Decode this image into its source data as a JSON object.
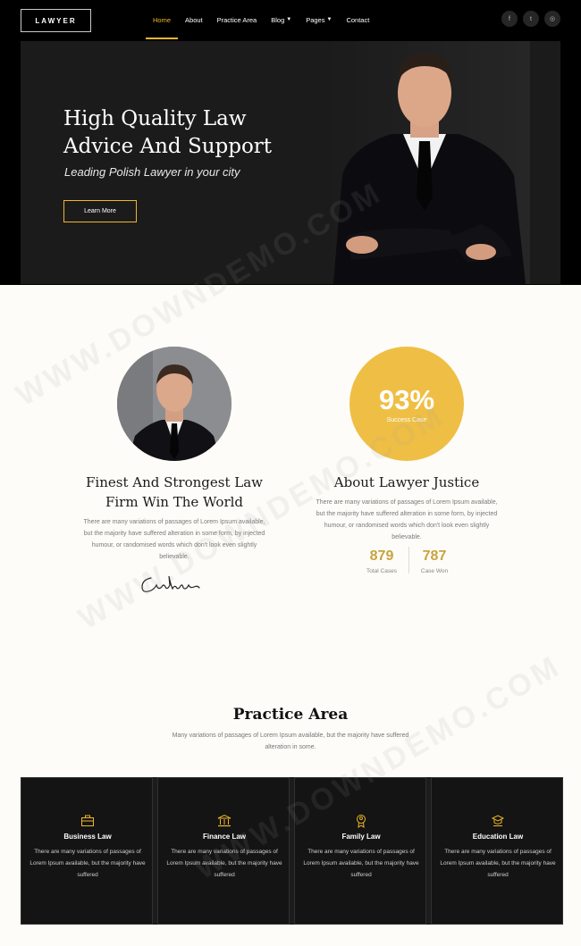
{
  "brand": {
    "logo": "LAWYER"
  },
  "nav": {
    "items": [
      {
        "label": "Home",
        "active": true
      },
      {
        "label": "About"
      },
      {
        "label": "Practice Area"
      },
      {
        "label": "Blog",
        "dropdown": true
      },
      {
        "label": "Pages",
        "dropdown": true
      },
      {
        "label": "Contact"
      }
    ],
    "socials": [
      {
        "icon": "facebook-icon",
        "glyph": "f"
      },
      {
        "icon": "twitter-icon",
        "glyph": "t"
      },
      {
        "icon": "instagram-icon",
        "glyph": "◎"
      }
    ]
  },
  "hero": {
    "title": "High Quality Law Advice And Support",
    "subtitle": "Leading Polish Lawyer in your city",
    "button": "Learn More"
  },
  "about_left": {
    "title": "Finest And Strongest Law Firm Win The World",
    "text": "There are many variations of passages of Lorem Ipsum available, but the majority have suffered alteration in some form, by injected humour, or randomised words which don't look even slightly believable.",
    "signature": "Catherine"
  },
  "about_right": {
    "percent": "93%",
    "percent_label": "Success Case",
    "title": "About Lawyer Justice",
    "text": "There are many variations of passages of Lorem Ipsum available, but the majority have suffered alteration in some form, by injected humour, or randomised words which don't look even slightly believable.",
    "counters": [
      {
        "value": "879",
        "label": "Total Cases"
      },
      {
        "value": "787",
        "label": "Case Won"
      }
    ]
  },
  "practice": {
    "title": "Practice Area",
    "desc": "Many variations of passages of Lorem Ipsum available, but the majority have suffered alteration in some.",
    "cards": [
      {
        "title": "Business Law",
        "icon": "briefcase-icon",
        "text": "There are many variations of passages of Lorem Ipsum available, but the majority have suffered"
      },
      {
        "title": "Finance Law",
        "icon": "bank-icon",
        "text": "There are many variations of passages of Lorem Ipsum available, but the majority have suffered"
      },
      {
        "title": "Family Law",
        "icon": "family-icon",
        "text": "There are many variations of passages of Lorem Ipsum available, but the majority have suffered"
      },
      {
        "title": "Education Law",
        "icon": "education-icon",
        "text": "There are many variations of passages of Lorem Ipsum available, but the majority have suffered"
      }
    ]
  },
  "watermark": "WWW.DOWNDEMO.COM",
  "colors": {
    "accent": "#f0b62a",
    "circle": "#efbf45",
    "counter": "#c9a33d",
    "dark": "#1b1b1b"
  }
}
